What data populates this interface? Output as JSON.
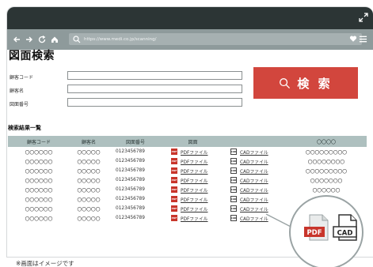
{
  "browser": {
    "url": "https://www.medi.co.jp/scanning/",
    "icons": [
      "back-arrow-icon",
      "forward-arrow-icon",
      "reload-icon",
      "home-icon",
      "search-icon",
      "heart-icon",
      "menu-icon",
      "expand-icon"
    ]
  },
  "page": {
    "title": "図面検索",
    "form": {
      "labels": [
        "顧客コード",
        "顧客名",
        "図面番号"
      ]
    },
    "search_button": "検 索",
    "results_title": "検索結果一覧"
  },
  "table": {
    "headers": [
      "顧客コード",
      "顧客名",
      "図面番号",
      "図面",
      "",
      "〇〇〇〇"
    ],
    "rows": [
      [
        "〇〇〇〇〇〇",
        "〇〇〇〇〇",
        "0123456789",
        "PDFファイル",
        "CADファイル",
        "〇〇〇〇〇〇〇〇〇"
      ],
      [
        "〇〇〇〇〇〇",
        "〇〇〇〇〇",
        "0123456789",
        "PDFファイル",
        "CADファイル",
        "〇〇〇〇〇〇〇〇"
      ],
      [
        "〇〇〇〇〇〇",
        "〇〇〇〇〇",
        "0123456789",
        "PDFファイル",
        "CADファイル",
        "〇〇〇〇〇〇〇〇〇"
      ],
      [
        "〇〇〇〇〇〇",
        "〇〇〇〇〇",
        "0123456789",
        "PDFファイル",
        "CADファイル",
        "〇〇〇〇〇〇〇"
      ],
      [
        "〇〇〇〇〇〇",
        "〇〇〇〇〇",
        "0123456789",
        "PDFファイル",
        "CADファイル",
        "〇〇〇〇〇〇"
      ],
      [
        "〇〇〇〇〇〇",
        "〇〇〇〇〇",
        "0123456789",
        "PDFファイル",
        "CADファイル",
        "〇〇〇〇"
      ],
      [
        "〇〇〇〇〇〇",
        "〇〇〇〇〇",
        "0123456789",
        "PDFファイル",
        "CADファイル",
        ""
      ],
      [
        "〇〇〇〇〇〇",
        "〇〇〇〇〇",
        "0123456789",
        "PDFファイル",
        "CADファイル",
        ""
      ]
    ],
    "pdf_icon_text": "PDF",
    "cad_icon_text": "CAD"
  },
  "zoom": {
    "pdf_text": "PDF",
    "cad_text": "CAD"
  },
  "footnote": "※画面はイメージです",
  "colors": {
    "titlebar": "#2c3535",
    "navbar": "#8e9a9b",
    "search_button": "#d2463d",
    "table_header": "#aec0bf",
    "pdf_red": "#c8352b"
  }
}
